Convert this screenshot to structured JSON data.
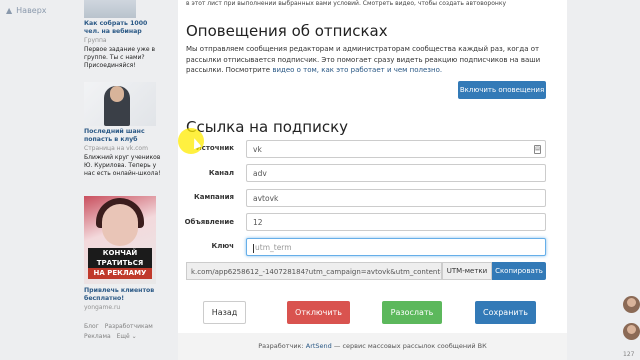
{
  "sidebar": {
    "back_label": "Наверх",
    "ads": [
      {
        "title": "Как собрать 1000 чел. на вебинар",
        "sub": "Группа",
        "text": "Первое задание уже в группе. Ты с нами? Присоединяйся!"
      },
      {
        "title": "Последний шанс попасть в клуб",
        "sub": "Страница на vk.com",
        "text": "Ближний круг учеников Ю. Курилова. Теперь у нас есть онлайн-школа!"
      },
      {
        "banner": [
          "КОНЧАЙ",
          "ТРАТИТЬСЯ",
          "НА РЕКЛАМУ"
        ],
        "title": "Привлечь клиентов бесплатно!",
        "sub": "yongame.ru"
      }
    ],
    "footer": [
      "Блог",
      "Разработчикам",
      "Реклама",
      "Ещё ⌄"
    ]
  },
  "main": {
    "top_fragment": "в этот лист при выполнении выбранных вами условий. Смотреть видео, чтобы создать автоворонку",
    "notif_title": "Оповещения об отписках",
    "notif_desc_1": "Мы отправляем сообщения редакторам и администраторам сообщества каждый раз, когда от рассылки отписывается подписчик. Это помогает сразу видеть реакцию подписчиков на ваши рассылки. Посмотрите",
    "notif_desc_link": "видео о том, как это работает и чем полезно.",
    "enable_button": "Включить оповещения",
    "sub_title": "Ссылка на подписку",
    "form": {
      "source_label": "Источник",
      "source_value": "vk",
      "channel_label": "Канал",
      "channel_value": "adv",
      "campaign_label": "Кампания",
      "campaign_value": "avtovk",
      "ad_label": "Объявление",
      "ad_value": "12",
      "key_label": "Ключ",
      "key_placeholder": "utm_term"
    },
    "url_value": "k.com/app6258612_-140728184?utm_campaign=avtovk&utm_content=12&ut",
    "utm_label": "UTM-метки",
    "copy_button": "Скопировать",
    "buttons": {
      "back": "Назад",
      "disable": "Отключить",
      "send": "Разослать",
      "save": "Сохранить"
    },
    "footer_prefix": "Разработчик:",
    "footer_link": "ArtSend",
    "footer_suffix": "— сервис массовых рассылок сообщений ВК"
  },
  "right": {
    "count": "127"
  },
  "colors": {
    "primary": "#337ab7",
    "danger": "#d9534f",
    "success": "#5cb85c",
    "link": "#2a5885"
  }
}
